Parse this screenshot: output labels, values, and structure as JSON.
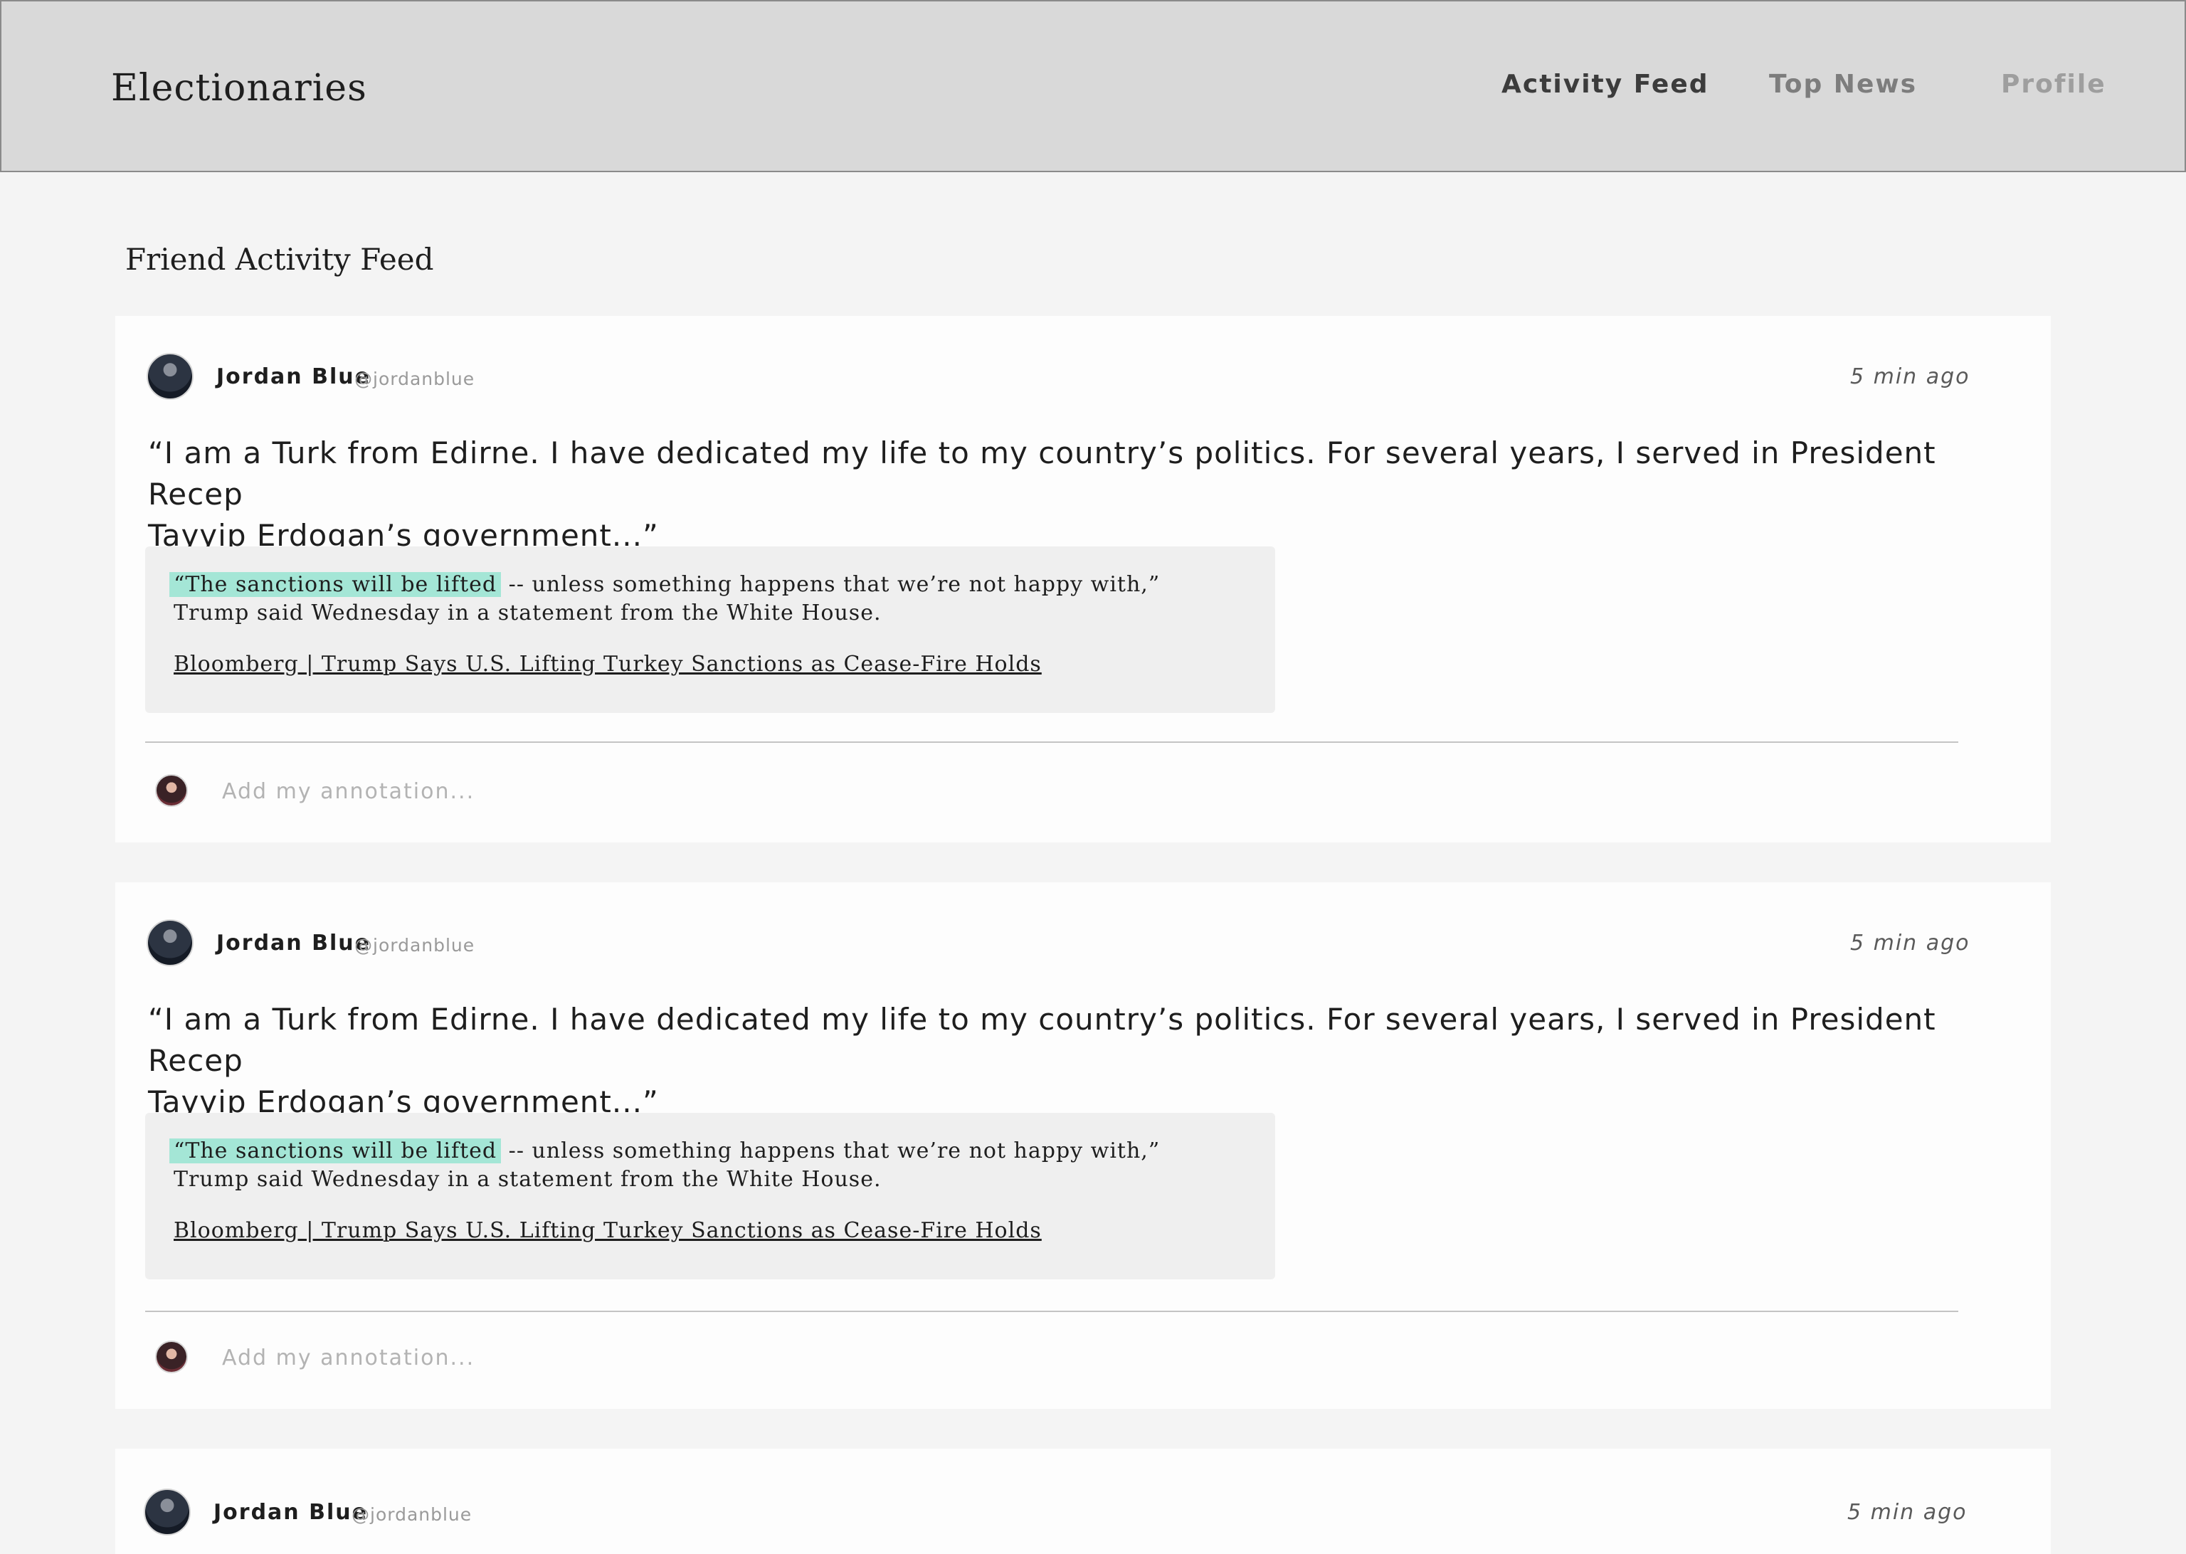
{
  "app": {
    "brand": "Electionaries"
  },
  "nav": {
    "items": [
      {
        "label": "Activity Feed"
      },
      {
        "label": "Top News"
      },
      {
        "label": "Profile"
      }
    ]
  },
  "page": {
    "title": "Friend Activity Feed"
  },
  "feed": [
    {
      "author_name": "Jordan Blue",
      "author_handle": "@jordanblue",
      "time": "5 min ago",
      "quote_line1": "“I am a Turk from Edirne. I have dedicated my life to my country’s politics. For several years, I served in President Recep",
      "quote_line2": "Tayyip Erdogan’s government...”",
      "excerpt_highlight": "“The sanctions will be lifted",
      "excerpt_rest": " -- unless something happens that we’re not happy with,”",
      "excerpt_line2": "Trump said Wednesday in a statement from the White House.",
      "source": "Bloomberg | Trump Says U.S. Lifting Turkey Sanctions as Cease-Fire Holds",
      "annotation_placeholder": "Add my annotation..."
    },
    {
      "author_name": "Jordan Blue",
      "author_handle": "@jordanblue",
      "time": "5 min ago",
      "quote_line1": "“I am a Turk from Edirne. I have dedicated my life to my country’s politics. For several years, I served in President Recep",
      "quote_line2": "Tayyip Erdogan’s government...”",
      "excerpt_highlight": "“The sanctions will be lifted",
      "excerpt_rest": " -- unless something happens that we’re not happy with,”",
      "excerpt_line2": "Trump said Wednesday in a statement from the White House.",
      "source": "Bloomberg | Trump Says U.S. Lifting Turkey Sanctions as Cease-Fire Holds",
      "annotation_placeholder": "Add my annotation..."
    },
    {
      "author_name": "Jordan Blue",
      "author_handle": "@jordanblue",
      "time": "5 min ago"
    }
  ],
  "colors": {
    "topbar_bg": "#d9d9d9",
    "page_bg": "#f4f4f4",
    "card_bg": "#fdfdfd",
    "excerpt_bg": "#efefef",
    "highlight": "#a4e6d6"
  },
  "icons": {
    "author_avatar": "avatar-icon",
    "my_avatar": "avatar-icon"
  }
}
